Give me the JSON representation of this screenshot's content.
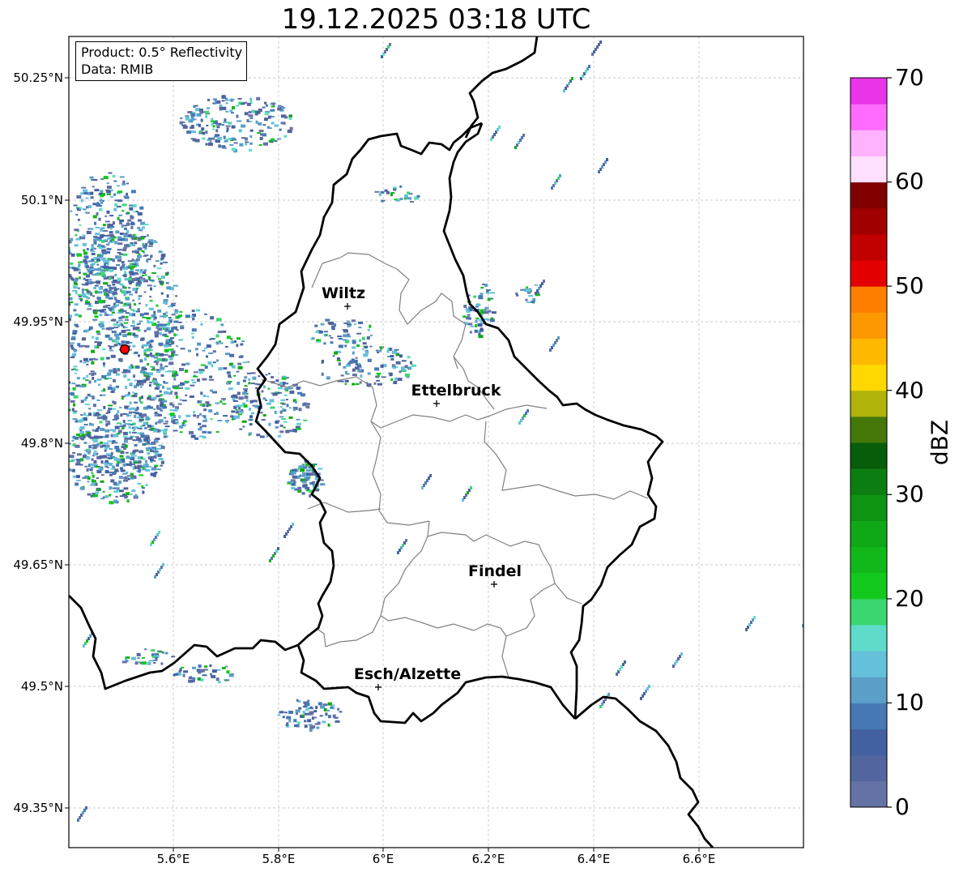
{
  "title": "19.12.2025 03:18 UTC",
  "info": {
    "product": "Product: 0.5° Reflectivity",
    "data": "Data: RMIB"
  },
  "axes": {
    "lat_labels": [
      "50.25°N",
      "50.1°N",
      "49.95°N",
      "49.8°N",
      "49.65°N",
      "49.5°N",
      "49.35°N"
    ],
    "lon_labels": [
      "5.6°E",
      "5.8°E",
      "6°E",
      "6.2°E",
      "6.4°E",
      "6.6°E"
    ]
  },
  "cities": [
    {
      "name": "Wiltz"
    },
    {
      "name": "Ettelbruck"
    },
    {
      "name": "Findel"
    },
    {
      "name": "Esch/Alzette"
    }
  ],
  "colorbar": {
    "unit": "dBZ",
    "tick_labels": [
      "0",
      "10",
      "20",
      "30",
      "40",
      "50",
      "60",
      "70"
    ],
    "colors": [
      "#6472a6",
      "#53659e",
      "#4361a1",
      "#4679b3",
      "#5b9ec7",
      "#64c0db",
      "#5fdbc9",
      "#3cd671",
      "#13c91e",
      "#12b81a",
      "#11a817",
      "#0e9313",
      "#0c7d10",
      "#085d0a",
      "#447809",
      "#afb30a",
      "#fed800",
      "#fdb800",
      "#fe9800",
      "#fe7f00",
      "#e20000",
      "#c20000",
      "#a00000",
      "#800000",
      "#ffe0ff",
      "#ffb3ff",
      "#ff6cff",
      "#e835e8"
    ]
  },
  "radar_site_color": "#ff0000"
}
